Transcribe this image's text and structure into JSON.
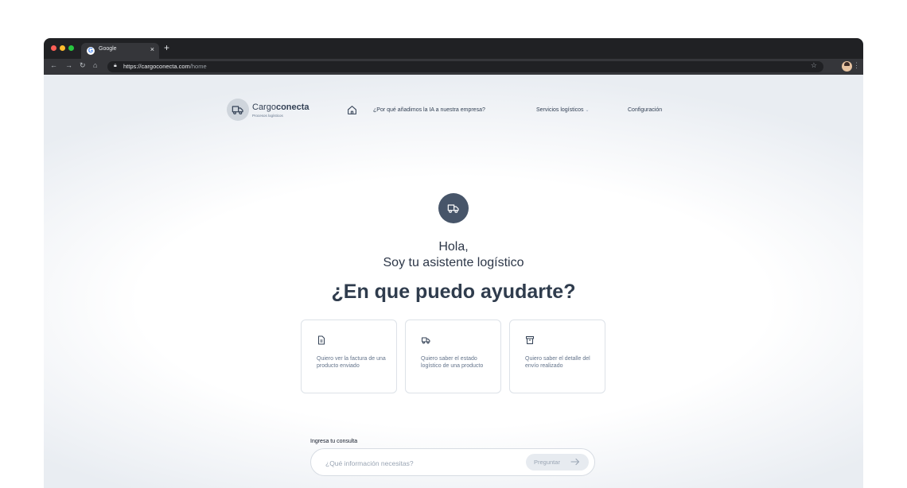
{
  "browser": {
    "tab_title": "Google",
    "tab_close": "×",
    "new_tab": "+",
    "url_host": "https://cargoconecta.com",
    "url_path": "/home",
    "icons": [
      "back-icon",
      "forward-icon",
      "reload-icon",
      "home-icon",
      "lock-icon",
      "star-icon",
      "kebab-icon"
    ]
  },
  "header": {
    "brand_light": "Cargo",
    "brand_bold": "conecta",
    "brand_sub": "Procesos logísticos",
    "nav": [
      {
        "label": "¿Por qué añadimos la IA a nuestra empresa?"
      },
      {
        "label": "Servicios logísticos",
        "has_dropdown": true
      },
      {
        "label": "Configuración"
      }
    ]
  },
  "hero": {
    "greeting": "Hola,",
    "intro": "Soy tu asistente logístico",
    "question": "¿En que puedo ayudarte?"
  },
  "suggestions": [
    {
      "icon": "document-icon",
      "text": "Quiero ver la factura de una producto enviado"
    },
    {
      "icon": "truck-icon",
      "text": "Quiero saber el estado logístico de una producto"
    },
    {
      "icon": "archive-icon",
      "text": "Quiero saber el detalle del envío realizado"
    }
  ],
  "query": {
    "label": "Ingresa tu consulta",
    "placeholder": "¿Qué información necesitas?",
    "button_label": "Preguntar"
  },
  "colors": {
    "accent": "#475569",
    "text": "#2f3c4d",
    "muted": "#64748b"
  }
}
